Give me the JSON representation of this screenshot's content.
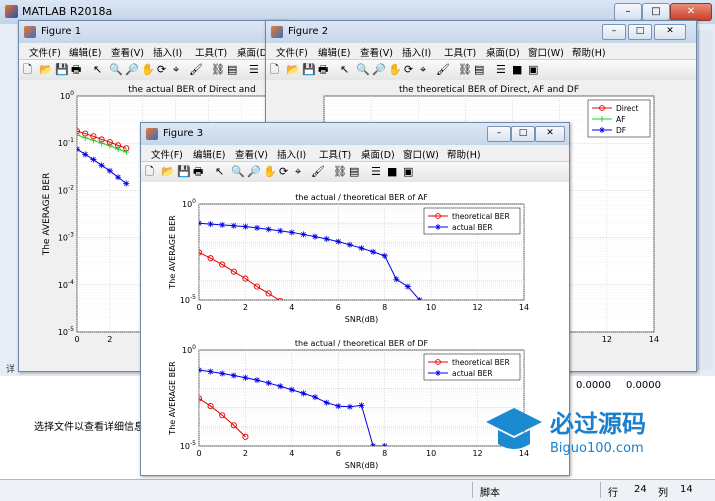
{
  "app": {
    "title": "MATLAB R2018a"
  },
  "window_controls": {
    "min": "–",
    "max": "□",
    "close": "✕"
  },
  "menu": [
    "文件(F)",
    "编辑(E)",
    "查看(V)",
    "插入(I)",
    "工具(T)",
    "桌面(D)",
    "窗口(W)",
    "帮助(H)"
  ],
  "fig1": {
    "title": "Figure 1"
  },
  "fig2": {
    "title": "Figure 2"
  },
  "fig3": {
    "title": "Figure 3"
  },
  "bottom": {
    "detail_hint": "选择文件以查看详细信息",
    "values": [
      "0.0000",
      "0.0000"
    ],
    "side_label": "详"
  },
  "status": {
    "script": "脚本",
    "row_label": "行",
    "row": "24",
    "col_label": "列",
    "col": "14"
  },
  "watermark": {
    "line1": "必过源码",
    "line2": "Biguo100.com"
  },
  "colors": {
    "red": "#e60000",
    "green": "#22cc22",
    "blue": "#0000e6"
  },
  "icons": [
    "new-file-icon",
    "open-folder-icon",
    "save-icon",
    "print-icon",
    "pointer-icon",
    "zoom-in-icon",
    "zoom-out-icon",
    "pan-icon",
    "rotate-icon",
    "data-cursor-icon",
    "brush-icon",
    "link-icon",
    "colorbar-icon",
    "legend-icon",
    "hide-tools-icon",
    "dock-icon"
  ],
  "chart_data": [
    {
      "type": "line",
      "title": "the actual BER of Direct and",
      "ylabel": "The AVERAGE BER",
      "xlabel": "",
      "scale": "log",
      "xlim": [
        0,
        14
      ],
      "ylim": [
        1e-05,
        1
      ],
      "xticks": [
        "0",
        "2",
        "4"
      ],
      "yticks": [
        "10^0",
        "10^-1",
        "10^-2",
        "10^-3",
        "10^-4",
        "10^-5"
      ],
      "grid": "on",
      "series": [
        {
          "name": "",
          "color": "#e60000",
          "marker": "o",
          "x": [
            0,
            0.5,
            1,
            1.5,
            2,
            2.5,
            3
          ],
          "y": [
            0.18,
            0.16,
            0.14,
            0.12,
            0.105,
            0.09,
            0.078
          ]
        },
        {
          "name": "",
          "color": "#22cc22",
          "marker": "+",
          "x": [
            0,
            0.5,
            1,
            1.5,
            2,
            2.5,
            3
          ],
          "y": [
            0.15,
            0.13,
            0.115,
            0.1,
            0.088,
            0.075,
            0.065
          ]
        },
        {
          "name": "",
          "color": "#0000e6",
          "marker": "*",
          "x": [
            0,
            0.5,
            1,
            1.5,
            2,
            2.5,
            3
          ],
          "y": [
            0.075,
            0.058,
            0.045,
            0.034,
            0.026,
            0.019,
            0.014
          ]
        }
      ]
    },
    {
      "type": "line",
      "title": "the theoretical BER of Direct, AF and DF",
      "ylabel": "",
      "xlabel": "",
      "scale": "log",
      "xlim": [
        0,
        14
      ],
      "ylim": [
        1e-05,
        1
      ],
      "xticks": [
        "12",
        "14"
      ],
      "grid": "on",
      "legend": {
        "placement": "top-right",
        "entries": [
          "Direct",
          "AF",
          "DF"
        ]
      },
      "series": [
        {
          "name": "Direct",
          "color": "#e60000",
          "marker": "o",
          "x": [],
          "y": []
        },
        {
          "name": "AF",
          "color": "#22cc22",
          "marker": "+",
          "x": [],
          "y": []
        },
        {
          "name": "DF",
          "color": "#0000e6",
          "marker": "*",
          "x": [],
          "y": []
        }
      ]
    },
    {
      "type": "line",
      "title": "the actual / theoretical BER of AF",
      "ylabel": "The AVERAGE BER",
      "xlabel": "SNR(dB)",
      "scale": "log",
      "xlim": [
        0,
        14
      ],
      "ylim": [
        1e-05,
        1
      ],
      "xticks": [
        "0",
        "2",
        "4",
        "6",
        "8",
        "10",
        "12",
        "14"
      ],
      "yticks": [
        "10^0",
        "10^-5"
      ],
      "grid": "on",
      "legend": {
        "placement": "top-right",
        "entries": [
          "theoretical BER",
          "actual BER"
        ]
      },
      "series": [
        {
          "name": "theoretical BER",
          "color": "#e60000",
          "marker": "o",
          "x": [
            0,
            0.5,
            1,
            1.5,
            2,
            2.5,
            3,
            3.5
          ],
          "y": [
            0.003,
            0.0015,
            0.0007,
            0.0003,
            0.00013,
            5e-05,
            2.2e-05,
            9e-06
          ]
        },
        {
          "name": "actual BER",
          "color": "#0000e6",
          "marker": "*",
          "x": [
            0,
            0.5,
            1,
            1.5,
            2,
            2.5,
            3,
            3.5,
            4,
            4.5,
            5,
            5.5,
            6,
            6.5,
            7,
            7.5,
            8,
            8.5,
            9,
            9.5
          ],
          "y": [
            0.1,
            0.09,
            0.082,
            0.074,
            0.066,
            0.057,
            0.048,
            0.04,
            0.033,
            0.026,
            0.02,
            0.015,
            0.011,
            0.0075,
            0.005,
            0.0032,
            0.002,
            0.00012,
            5e-05,
            1e-05
          ]
        }
      ]
    },
    {
      "type": "line",
      "title": "the actual / theoretical BER of DF",
      "ylabel": "The AVERAGE BER",
      "xlabel": "SNR(dB)",
      "scale": "log",
      "xlim": [
        0,
        14
      ],
      "ylim": [
        1e-05,
        1
      ],
      "xticks": [
        "0",
        "2",
        "4",
        "6",
        "8",
        "10",
        "12",
        "14"
      ],
      "yticks": [
        "10^0",
        "10^-5"
      ],
      "grid": "on",
      "legend": {
        "placement": "top-right",
        "entries": [
          "theoretical BER",
          "actual BER"
        ]
      },
      "series": [
        {
          "name": "theoretical BER",
          "color": "#e60000",
          "marker": "o",
          "x": [
            0,
            0.5,
            1,
            1.5,
            2
          ],
          "y": [
            0.003,
            0.0012,
            0.0004,
            0.00012,
            3e-05
          ]
        },
        {
          "name": "actual BER",
          "color": "#0000e6",
          "marker": "*",
          "x": [
            0,
            0.5,
            1,
            1.5,
            2,
            2.5,
            3,
            3.5,
            4,
            4.5,
            5,
            5.5,
            6,
            6.5,
            7,
            7.5,
            8
          ],
          "y": [
            0.09,
            0.075,
            0.06,
            0.047,
            0.036,
            0.027,
            0.019,
            0.013,
            0.0085,
            0.0055,
            0.0035,
            0.0018,
            0.0012,
            0.0011,
            0.0013,
            1e-05,
            1e-05
          ]
        }
      ]
    }
  ]
}
